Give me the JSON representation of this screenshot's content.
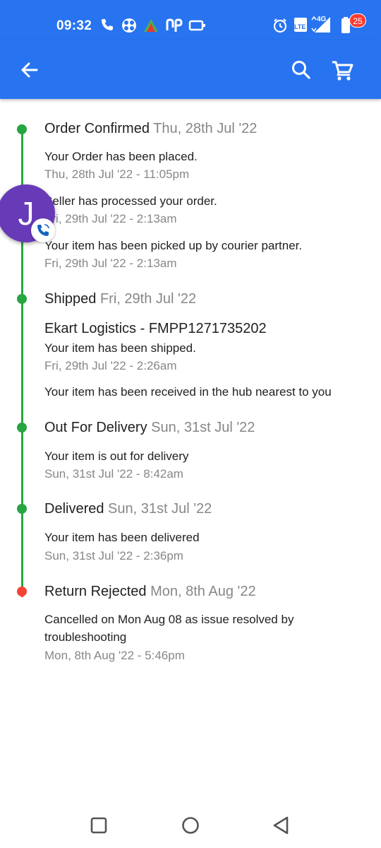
{
  "status_bar": {
    "time": "09:32",
    "icons": [
      "phone-icon",
      "app-icon",
      "triangle-app-icon",
      "np-app-icon",
      "screen-icon",
      "alarm-icon",
      "volte-icon",
      "signal-4g-icon",
      "battery-icon"
    ],
    "network_label": "4G",
    "volte_label": "LTE"
  },
  "app_bar": {
    "cart_count": "25",
    "colors": {
      "primary": "#2874f0",
      "badge": "#ff3b30"
    }
  },
  "chat_head": {
    "initial": "J",
    "color": "#673ab7"
  },
  "timeline": {
    "colors": {
      "done": "#26a541",
      "rejected": "#f44336"
    },
    "stages": [
      {
        "title": "Order Confirmed",
        "date": "Thu, 28th Jul '22",
        "events": [
          {
            "text": "Your Order has been placed.",
            "time": "Thu, 28th Jul '22 - 11:05pm"
          },
          {
            "text": "Seller has processed your order.",
            "time": "Fri, 29th Jul '22 - 2:13am"
          },
          {
            "text": "Your item has been picked up by courier partner.",
            "time": "Fri, 29th Jul '22 - 2:13am"
          }
        ]
      },
      {
        "title": "Shipped",
        "date": "Fri, 29th Jul '22",
        "courier": "Ekart Logistics - FMPP1271735202",
        "events": [
          {
            "text": "Your item has been shipped.",
            "time": "Fri, 29th Jul '22 - 2:26am"
          },
          {
            "text": "Your item has been received in the hub nearest to you"
          }
        ]
      },
      {
        "title": "Out For Delivery",
        "date": "Sun, 31st Jul '22",
        "events": [
          {
            "text": "Your item is out for delivery",
            "time": "Sun, 31st Jul '22 - 8:42am"
          }
        ]
      },
      {
        "title": "Delivered",
        "date": "Sun, 31st Jul '22",
        "events": [
          {
            "text": "Your item has been delivered",
            "time": "Sun, 31st Jul '22 - 2:36pm"
          }
        ]
      },
      {
        "title": "Return Rejected",
        "date": "Mon, 8th Aug '22",
        "events": [
          {
            "text": "Cancelled on Mon Aug 08 as issue resolved by",
            "text2": "troubleshooting",
            "time": "Mon, 8th Aug '22 - 5:46pm"
          }
        ]
      }
    ]
  }
}
